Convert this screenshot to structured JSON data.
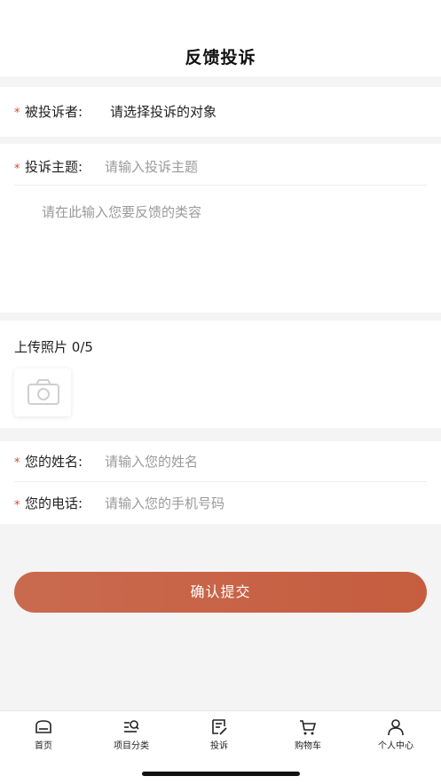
{
  "header": {
    "title": "反馈投诉"
  },
  "complaint_target": {
    "label": "被投诉者:",
    "value": "请选择投诉的对象"
  },
  "complaint_subject": {
    "label": "投诉主题:",
    "placeholder": "请输入投诉主题"
  },
  "feedback_content": {
    "placeholder": "请在此输入您要反馈的类容"
  },
  "upload": {
    "label": "上传照片",
    "count": "0/5"
  },
  "name_field": {
    "label": "您的姓名:",
    "placeholder": "请输入您的姓名"
  },
  "phone_field": {
    "label": "您的电话:",
    "placeholder": "请输入您的手机号码"
  },
  "required_mark": "*",
  "submit": {
    "label": "确认提交"
  },
  "tabbar": {
    "items": [
      {
        "label": "首页",
        "icon": "home-icon"
      },
      {
        "label": "项目分类",
        "icon": "category-search-icon"
      },
      {
        "label": "投诉",
        "icon": "complaint-edit-icon"
      },
      {
        "label": "购物车",
        "icon": "cart-icon"
      },
      {
        "label": "个人中心",
        "icon": "user-icon"
      }
    ]
  },
  "colors": {
    "accent": "#c65d3f",
    "required": "#d24a2f",
    "background": "#f4f4f4"
  }
}
